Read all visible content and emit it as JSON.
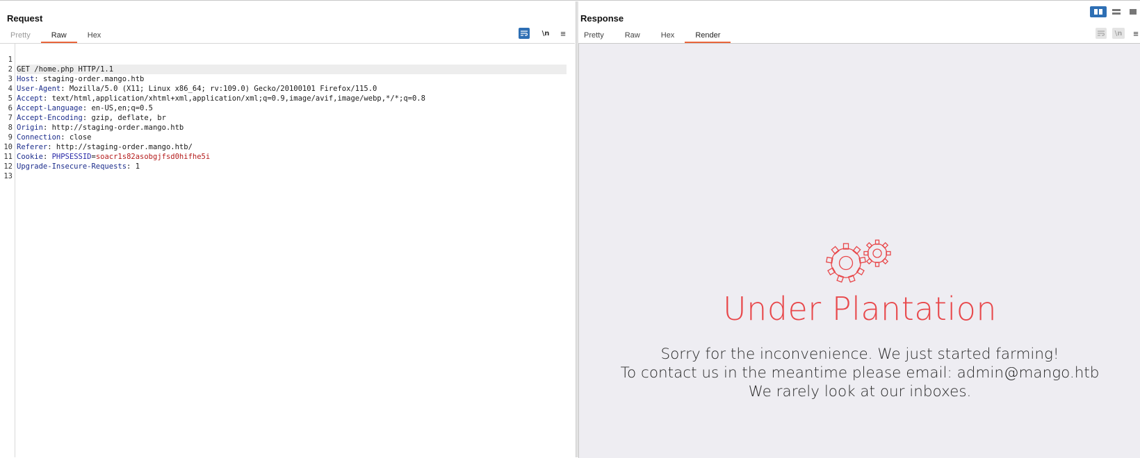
{
  "request": {
    "title": "Request",
    "tabs": [
      "Pretty",
      "Raw",
      "Hex"
    ],
    "active_tab": "Raw",
    "toolbar": {
      "newline_label": "\\n",
      "wrap_icon": "word-wrap-icon",
      "menu_icon": "hamburger-menu-icon"
    },
    "lines": [
      {
        "n": "1",
        "text": "GET /home.php HTTP/1.1"
      },
      {
        "n": "2",
        "name": "Host",
        "value": "staging-order.mango.htb"
      },
      {
        "n": "3",
        "name": "User-Agent",
        "value": "Mozilla/5.0 (X11; Linux x86_64; rv:109.0) Gecko/20100101 Firefox/115.0"
      },
      {
        "n": "4",
        "name": "Accept",
        "value": "text/html,application/xhtml+xml,application/xml;q=0.9,image/avif,image/webp,*/*;q=0.8"
      },
      {
        "n": "5",
        "name": "Accept-Language",
        "value": "en-US,en;q=0.5"
      },
      {
        "n": "6",
        "name": "Accept-Encoding",
        "value": "gzip, deflate, br"
      },
      {
        "n": "7",
        "name": "Origin",
        "value": "http://staging-order.mango.htb"
      },
      {
        "n": "8",
        "name": "Connection",
        "value": "close"
      },
      {
        "n": "9",
        "name": "Referer",
        "value": "http://staging-order.mango.htb/"
      },
      {
        "n": "10",
        "name": "Cookie",
        "cookie_name": "PHPSESSID",
        "cookie_value": "soacr1s82asobgjfsd0hifhe5i"
      },
      {
        "n": "11",
        "name": "Upgrade-Insecure-Requests",
        "value": "1"
      },
      {
        "n": "12",
        "text": ""
      },
      {
        "n": "13",
        "text": ""
      }
    ]
  },
  "response": {
    "title": "Response",
    "tabs": [
      "Pretty",
      "Raw",
      "Hex",
      "Render"
    ],
    "active_tab": "Render",
    "toolbar": {
      "newline_label": "\\n"
    },
    "render": {
      "icon": "gears-icon",
      "headline": "Under Plantation",
      "messages": [
        "Sorry for the inconvenience. We just started farming!",
        "To contact us in the meantime please email: admin@mango.htb",
        "We rarely look at our inboxes."
      ],
      "accent_color": "#e8484b"
    }
  },
  "layout_toggles": [
    "split-horizontal-icon",
    "split-vertical-icon",
    "tabs-icon"
  ],
  "colors": {
    "active_tab_underline": "#e8643a",
    "toolbar_active": "#2e6fb4"
  }
}
